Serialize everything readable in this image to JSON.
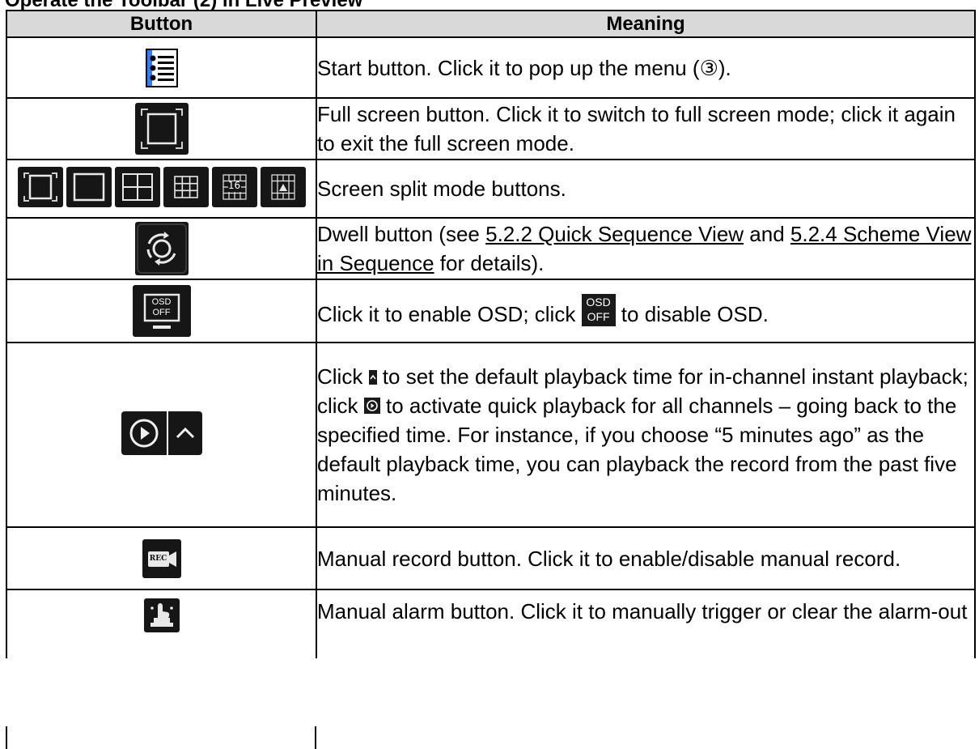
{
  "heading": "Operate the Toolbar (2) in Live Preview",
  "table": {
    "header": {
      "button": "Button",
      "meaning": "Meaning"
    },
    "rows": [
      {
        "icon": "start-menu-icon",
        "text": "Start button. Click it to pop up the menu (③)."
      },
      {
        "icon": "fullscreen-icon",
        "text": "Full screen button. Click it to switch to full screen mode; click it again to exit the full screen mode."
      },
      {
        "icons": [
          "fullscreen-icon",
          "split-1-icon",
          "split-4-icon",
          "split-9-icon",
          "split-16-icon",
          "split-custom-icon"
        ],
        "icon_labels": [
          "16"
        ],
        "text": "Screen split mode buttons."
      },
      {
        "icon": "dwell-icon",
        "text_before": "Dwell button (see ",
        "link1": "5.2.2 Quick Sequence View",
        "text_mid": " and ",
        "link2": "5.2.4 Scheme View in Sequence",
        "text_after": " for details)."
      },
      {
        "icon": "osd-icon",
        "icon_label_top": "OSD",
        "icon_label_bottom": "OFF",
        "text_before": "Click it to enable OSD; click ",
        "text_after": " to disable OSD."
      },
      {
        "icon": "playback-icon",
        "text_before": "Click ",
        "text_mid": " to set the default playback time for in-channel instant playback; click ",
        "text_after": " to activate quick playback for all channels – going back to the specified time. For instance, if you choose “5 minutes ago” as the default playback time, you can playback the record from the past five minutes."
      },
      {
        "icon": "record-icon",
        "icon_label": "REC",
        "text": "Manual record button. Click it to enable/disable manual record."
      },
      {
        "icon": "alarm-icon",
        "text": "Manual alarm button. Click it to manually trigger or clear the alarm-out"
      }
    ]
  },
  "colors": {
    "icon_bg": "#161616",
    "header_bg": "#d9d9d9",
    "accent_red": "#c00000"
  }
}
